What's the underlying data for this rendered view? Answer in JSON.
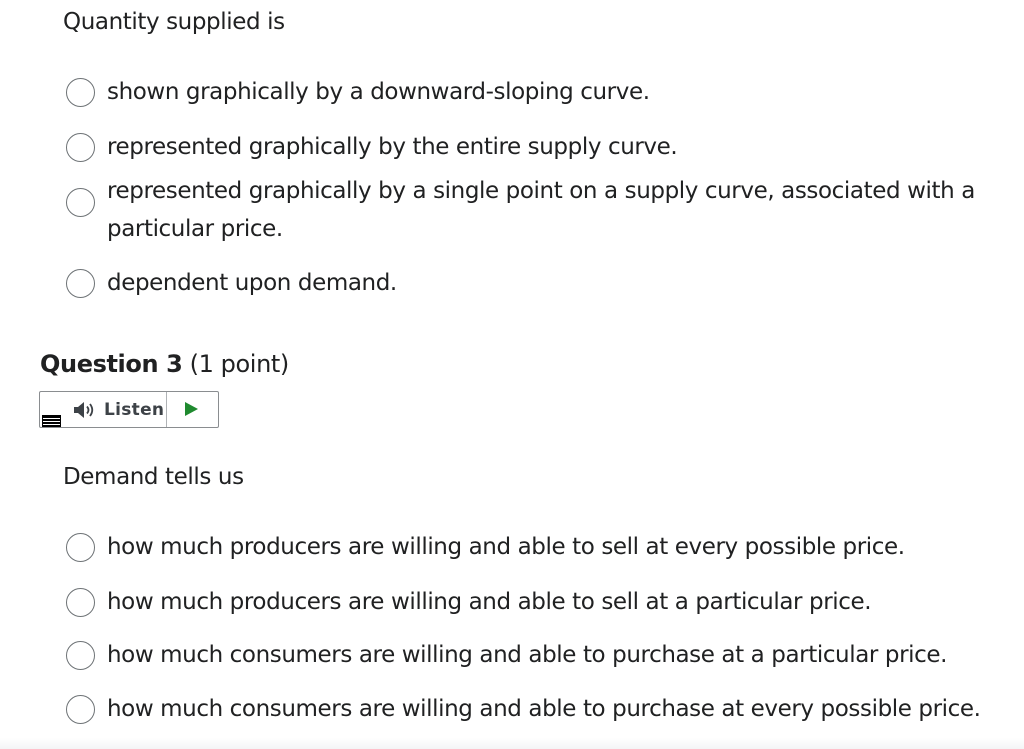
{
  "question2": {
    "stem": "Quantity supplied is",
    "options": [
      "shown graphically by a downward-sloping curve.",
      "represented graphically by the entire supply curve.",
      "represented graphically by a single point on a supply curve, associated with a particular price.",
      "dependent upon demand."
    ]
  },
  "question3": {
    "title": "Question 3",
    "points": "(1 point)",
    "listen": {
      "label": "Listen",
      "menu_icon": "menu-icon",
      "speaker_icon": "speaker-icon",
      "play_icon": "play-icon",
      "play_color": "#1f8a2f"
    },
    "stem": "Demand tells us",
    "options": [
      "how much producers are willing and able to sell at every possible price.",
      "how much producers are willing and able to sell at a particular price.",
      "how much consumers are willing and able to purchase at a particular price.",
      "how much consumers are willing and able to purchase at every possible price."
    ]
  }
}
